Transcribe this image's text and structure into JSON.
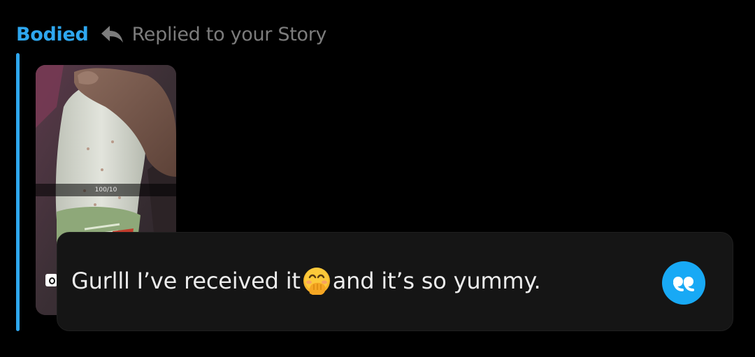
{
  "header": {
    "sender_name": "Bodied",
    "reply_label": "Replied to your Story",
    "reply_icon": "reply-arrow-icon"
  },
  "story": {
    "caption": "100/10"
  },
  "message": {
    "text_before_emoji": "Gurlll I’ve received it",
    "emoji": "face-with-hand-over-mouth",
    "text_after_emoji": "and it’s so yummy.",
    "quote_icon": "quote-icon"
  },
  "colors": {
    "accent": "#2ea7f0",
    "muted_text": "#7c7c7c",
    "bubble_bg": "#151515",
    "quote_button": "#18a9f5"
  }
}
